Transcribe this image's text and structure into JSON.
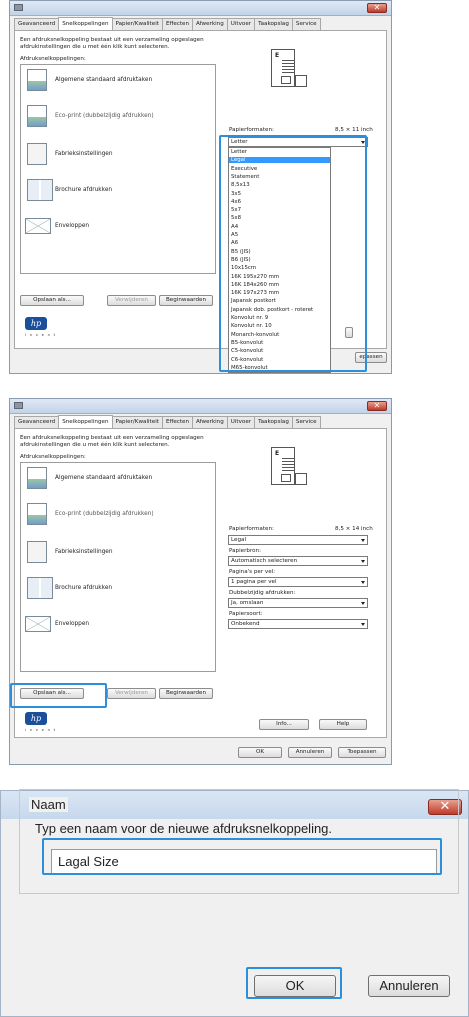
{
  "win1": {
    "tabs": [
      "Geavanceerd",
      "Snelkoppelingen",
      "Papier/Kwaliteit",
      "Effecten",
      "Afwerking",
      "Uitvoer",
      "Taakopslag",
      "Service"
    ],
    "description": "Een afdruksnelkoppeling bestaat uit een verzameling opgeslagen afdrukinstellingen die u met één klik kunt selecteren.",
    "list_label": "Afdruksnelkoppelingen:",
    "shortcuts": [
      "Algemene standaard afdruktaken",
      "Eco-print (dubbelzijdig afdrukken)",
      "Fabrieksinstellingen",
      "Brochure afdrukken",
      "Enveloppen"
    ],
    "paper_label": "Papierformaten:",
    "paper_size_text": "8,5 × 11 inch",
    "paper_selected": "Letter",
    "paper_options": [
      "Letter",
      "Legal",
      "Executive",
      "Statement",
      "8,5x13",
      "3x5",
      "4x6",
      "5x7",
      "5x8",
      "A4",
      "A5",
      "A6",
      "B5 (JIS)",
      "B6 (JIS)",
      "10x15cm",
      "16K 195x270 mm",
      "16K 184x260 mm",
      "16K 197x273 mm",
      "Japansk postkort",
      "Japansk dob. postkort - roteret",
      "Konvolut nr. 9",
      "Konvolut nr. 10",
      "Monarch-konvolut",
      "B5-konvolut",
      "C5-konvolut",
      "C6-konvolut",
      "M65-konvolut"
    ],
    "highlighted_option": "Legal",
    "buttons": {
      "save": "Opslaan als...",
      "delete": "Verwijderen",
      "defaults": "Beginwaarden",
      "apply_partial": "epassen"
    },
    "hp_logo": "hp",
    "hp_invent": "i n v e n t"
  },
  "win2": {
    "tabs": [
      "Geavanceerd",
      "Snelkoppelingen",
      "Papier/Kwaliteit",
      "Effecten",
      "Afwerking",
      "Uitvoer",
      "Taakopslag",
      "Service"
    ],
    "description": "Een afdruksnelkoppeling bestaat uit een verzameling opgeslagen afdrukinstellingen die u met één klik kunt selecteren.",
    "list_label": "Afdruksnelkoppelingen:",
    "shortcuts": [
      "Algemene standaard afdruktaken",
      "Eco-print (dubbelzijdig afdrukken)",
      "Fabrieksinstellingen",
      "Brochure afdrukken",
      "Enveloppen"
    ],
    "paper_label": "Papierformaten:",
    "paper_size_text": "8,5 × 14 inch",
    "paper_value": "Legal",
    "source_label": "Papierbron:",
    "source_value": "Automatisch selecteren",
    "pages_label": "Pagina's per vel:",
    "pages_value": "1 pagina per vel",
    "duplex_label": "Dubbelzijdig afdrukken:",
    "duplex_value": "Ja, omslaan",
    "type_label": "Papiersoort:",
    "type_value": "Onbekend",
    "buttons": {
      "save": "Opslaan als...",
      "delete": "Verwijderen",
      "defaults": "Beginwaarden",
      "info": "Info...",
      "help": "Help",
      "ok": "OK",
      "cancel": "Annuleren",
      "apply": "Toepassen"
    },
    "hp_logo": "hp",
    "hp_invent": "i n v e n t"
  },
  "dialog": {
    "group_label": "Naam",
    "instruction": "Typ een naam voor de nieuwe afdruksnelkoppeling.",
    "input_value": "Lagal Size",
    "ok": "OK",
    "cancel": "Annuleren"
  },
  "colors": {
    "highlight_border": "#2b8fd9",
    "selection": "#3399ff",
    "hp_blue": "#1b4f9c",
    "close_red": "#c0392b"
  }
}
